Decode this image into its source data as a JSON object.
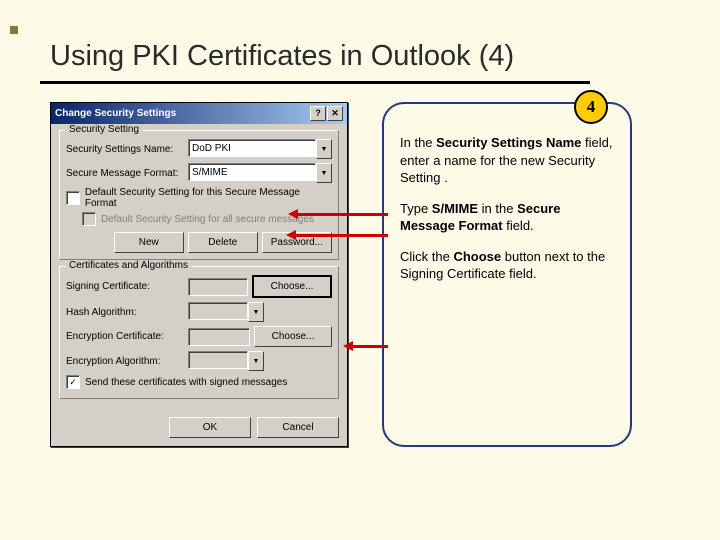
{
  "title": "Using PKI Certificates in Outlook (4)",
  "dialog": {
    "title": "Change Security Settings",
    "group1": {
      "title": "Security Setting",
      "name_label": "Security Settings Name:",
      "name_value": "DoD PKI",
      "format_label": "Secure Message Format:",
      "format_value": "S/MIME",
      "chk1": "Default Security Setting for this Secure Message Format",
      "chk2": "Default Security Setting for all secure messages",
      "btn_new": "New",
      "btn_delete": "Delete",
      "btn_password": "Password..."
    },
    "group2": {
      "title": "Certificates and Algorithms",
      "sign_cert_label": "Signing Certificate:",
      "hash_label": "Hash Algorithm:",
      "enc_cert_label": "Encryption Certificate:",
      "enc_alg_label": "Encryption Algorithm:",
      "choose": "Choose...",
      "chk_send": "Send these certificates with signed messages"
    },
    "ok": "OK",
    "cancel": "Cancel"
  },
  "callout": {
    "badge": "4",
    "p1_a": "In the ",
    "p1_b": "Security Settings Name",
    "p1_c": " field, enter a name for the new Security Setting .",
    "p2_a": "Type ",
    "p2_b": "S/MIME",
    "p2_c": " in the ",
    "p2_d": "Secure Message Format",
    "p2_e": " field.",
    "p3_a": "Click the ",
    "p3_b": "Choose",
    "p3_c": " button next to the Signing Certificate field."
  }
}
